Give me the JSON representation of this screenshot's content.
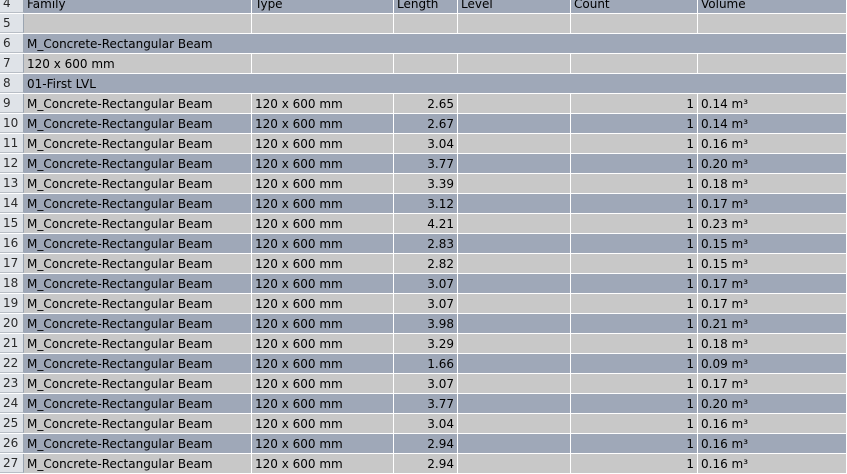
{
  "header_row": {
    "row_number": "4",
    "columns": [
      "Family",
      "Type",
      "Length",
      "Level",
      "Count",
      "Volume"
    ]
  },
  "blank_row": {
    "row_number": "5"
  },
  "group_rows": [
    {
      "row_number": "6",
      "label": "M_Concrete-Rectangular Beam"
    },
    {
      "row_number": "7",
      "label": "120 x 600 mm"
    },
    {
      "row_number": "8",
      "label": "01-First LVL"
    }
  ],
  "data_rows": [
    {
      "row_number": "9",
      "family": "M_Concrete-Rectangular Beam",
      "type": "120 x 600 mm",
      "length": "2.65",
      "level": "",
      "count": "1",
      "volume": "0.14 m³"
    },
    {
      "row_number": "10",
      "family": "M_Concrete-Rectangular Beam",
      "type": "120 x 600 mm",
      "length": "2.67",
      "level": "",
      "count": "1",
      "volume": "0.14 m³"
    },
    {
      "row_number": "11",
      "family": "M_Concrete-Rectangular Beam",
      "type": "120 x 600 mm",
      "length": "3.04",
      "level": "",
      "count": "1",
      "volume": "0.16 m³"
    },
    {
      "row_number": "12",
      "family": "M_Concrete-Rectangular Beam",
      "type": "120 x 600 mm",
      "length": "3.77",
      "level": "",
      "count": "1",
      "volume": "0.20 m³"
    },
    {
      "row_number": "13",
      "family": "M_Concrete-Rectangular Beam",
      "type": "120 x 600 mm",
      "length": "3.39",
      "level": "",
      "count": "1",
      "volume": "0.18 m³"
    },
    {
      "row_number": "14",
      "family": "M_Concrete-Rectangular Beam",
      "type": "120 x 600 mm",
      "length": "3.12",
      "level": "",
      "count": "1",
      "volume": "0.17 m³"
    },
    {
      "row_number": "15",
      "family": "M_Concrete-Rectangular Beam",
      "type": "120 x 600 mm",
      "length": "4.21",
      "level": "",
      "count": "1",
      "volume": "0.23 m³"
    },
    {
      "row_number": "16",
      "family": "M_Concrete-Rectangular Beam",
      "type": "120 x 600 mm",
      "length": "2.83",
      "level": "",
      "count": "1",
      "volume": "0.15 m³"
    },
    {
      "row_number": "17",
      "family": "M_Concrete-Rectangular Beam",
      "type": "120 x 600 mm",
      "length": "2.82",
      "level": "",
      "count": "1",
      "volume": "0.15 m³"
    },
    {
      "row_number": "18",
      "family": "M_Concrete-Rectangular Beam",
      "type": "120 x 600 mm",
      "length": "3.07",
      "level": "",
      "count": "1",
      "volume": "0.17 m³"
    },
    {
      "row_number": "19",
      "family": "M_Concrete-Rectangular Beam",
      "type": "120 x 600 mm",
      "length": "3.07",
      "level": "",
      "count": "1",
      "volume": "0.17 m³"
    },
    {
      "row_number": "20",
      "family": "M_Concrete-Rectangular Beam",
      "type": "120 x 600 mm",
      "length": "3.98",
      "level": "",
      "count": "1",
      "volume": "0.21 m³"
    },
    {
      "row_number": "21",
      "family": "M_Concrete-Rectangular Beam",
      "type": "120 x 600 mm",
      "length": "3.29",
      "level": "",
      "count": "1",
      "volume": "0.18 m³"
    },
    {
      "row_number": "22",
      "family": "M_Concrete-Rectangular Beam",
      "type": "120 x 600 mm",
      "length": "1.66",
      "level": "",
      "count": "1",
      "volume": "0.09 m³"
    },
    {
      "row_number": "23",
      "family": "M_Concrete-Rectangular Beam",
      "type": "120 x 600 mm",
      "length": "3.07",
      "level": "",
      "count": "1",
      "volume": "0.17 m³"
    },
    {
      "row_number": "24",
      "family": "M_Concrete-Rectangular Beam",
      "type": "120 x 600 mm",
      "length": "3.77",
      "level": "",
      "count": "1",
      "volume": "0.20 m³"
    },
    {
      "row_number": "25",
      "family": "M_Concrete-Rectangular Beam",
      "type": "120 x 600 mm",
      "length": "3.04",
      "level": "",
      "count": "1",
      "volume": "0.16 m³"
    },
    {
      "row_number": "26",
      "family": "M_Concrete-Rectangular Beam",
      "type": "120 x 600 mm",
      "length": "2.94",
      "level": "",
      "count": "1",
      "volume": "0.16 m³"
    },
    {
      "row_number": "27",
      "family": "M_Concrete-Rectangular Beam",
      "type": "120 x 600 mm",
      "length": "2.94",
      "level": "",
      "count": "1",
      "volume": "0.16 m³"
    }
  ],
  "colors": {
    "band_dark": "#9fa8b8",
    "band_light": "#c8c8c8",
    "row_header": "#dfe3e8"
  }
}
